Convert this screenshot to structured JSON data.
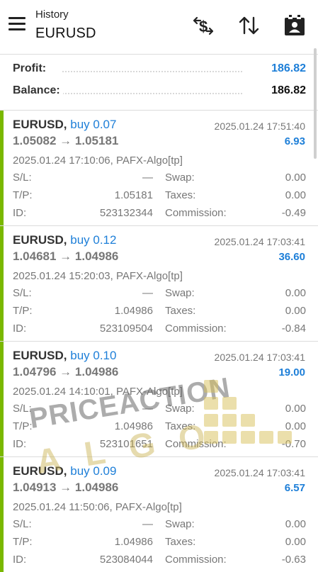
{
  "header": {
    "subtitle": "History",
    "title": "EURUSD",
    "icons": [
      "menu-icon",
      "dollar-exchange-icon",
      "sort-icon",
      "calendar-icon"
    ]
  },
  "summary": {
    "profit_label": "Profit:",
    "profit_value": "186.82",
    "balance_label": "Balance:",
    "balance_value": "186.82"
  },
  "colors": {
    "accent": "#1e7fd8",
    "buy_bar": "#7ab800"
  },
  "trades": [
    {
      "symbol": "EURUSD,",
      "side": "buy 0.07",
      "close_time": "2025.01.24 17:51:40",
      "prices": "1.05082 → 1.05181",
      "profit": "6.93",
      "open": "2025.01.24 17:10:06, PAFX-Algo[tp]",
      "sl_label": "S/L:",
      "sl": "—",
      "swap_label": "Swap:",
      "swap": "0.00",
      "tp_label": "T/P:",
      "tp": "1.05181",
      "taxes_label": "Taxes:",
      "taxes": "0.00",
      "id_label": "ID:",
      "id": "523132344",
      "commission_label": "Commission:",
      "commission": "-0.49"
    },
    {
      "symbol": "EURUSD,",
      "side": "buy 0.12",
      "close_time": "2025.01.24 17:03:41",
      "prices": "1.04681 → 1.04986",
      "profit": "36.60",
      "open": "2025.01.24 15:20:03, PAFX-Algo[tp]",
      "sl_label": "S/L:",
      "sl": "—",
      "swap_label": "Swap:",
      "swap": "0.00",
      "tp_label": "T/P:",
      "tp": "1.04986",
      "taxes_label": "Taxes:",
      "taxes": "0.00",
      "id_label": "ID:",
      "id": "523109504",
      "commission_label": "Commission:",
      "commission": "-0.84"
    },
    {
      "symbol": "EURUSD,",
      "side": "buy 0.10",
      "close_time": "2025.01.24 17:03:41",
      "prices": "1.04796 → 1.04986",
      "profit": "19.00",
      "open": "2025.01.24 14:10:01, PAFX-Algo[tp]",
      "sl_label": "S/L:",
      "sl": "—",
      "swap_label": "Swap:",
      "swap": "0.00",
      "tp_label": "T/P:",
      "tp": "1.04986",
      "taxes_label": "Taxes:",
      "taxes": "0.00",
      "id_label": "ID:",
      "id": "523101651",
      "commission_label": "Commission:",
      "commission": "-0.70"
    },
    {
      "symbol": "EURUSD,",
      "side": "buy 0.09",
      "close_time": "2025.01.24 17:03:41",
      "prices": "1.04913 → 1.04986",
      "profit": "6.57",
      "open": "2025.01.24 11:50:06, PAFX-Algo[tp]",
      "sl_label": "S/L:",
      "sl": "—",
      "swap_label": "Swap:",
      "swap": "0.00",
      "tp_label": "T/P:",
      "tp": "1.04986",
      "taxes_label": "Taxes:",
      "taxes": "0.00",
      "id_label": "ID:",
      "id": "523084044",
      "commission_label": "Commission:",
      "commission": "-0.63"
    }
  ],
  "watermark": {
    "line1": "PRICEACTION",
    "line2": "ALGO"
  }
}
